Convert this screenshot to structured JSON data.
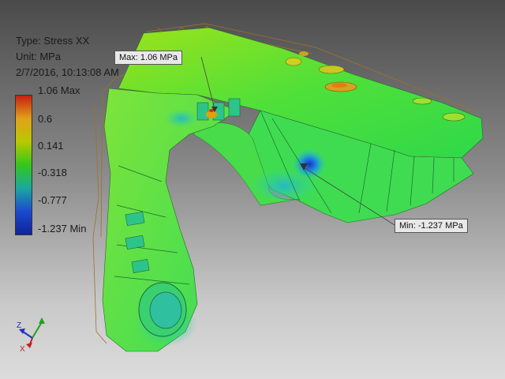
{
  "result_header": {
    "type_line": "Type: Stress XX",
    "unit_line": "Unit: MPa",
    "timestamp": "2/7/2016, 10:13:08 AM"
  },
  "legend": {
    "ticks": [
      "1.06 Max",
      "0.6",
      "0.141",
      "-0.318",
      "-0.777",
      "-1.237 Min"
    ],
    "colors": [
      "#c81e12",
      "#e0a21a",
      "#b9c800",
      "#33c81a",
      "#1aa8a0",
      "#1a4ad0",
      "#10239a"
    ]
  },
  "probes": {
    "max_label": "Max: 1.06 MPa",
    "min_label": "Min: -1.237 MPa"
  },
  "triad": {
    "z_label": "Z",
    "x_label": "X",
    "z_color": "#2030c0",
    "x_color": "#c02020",
    "y_color": "#20a020"
  }
}
